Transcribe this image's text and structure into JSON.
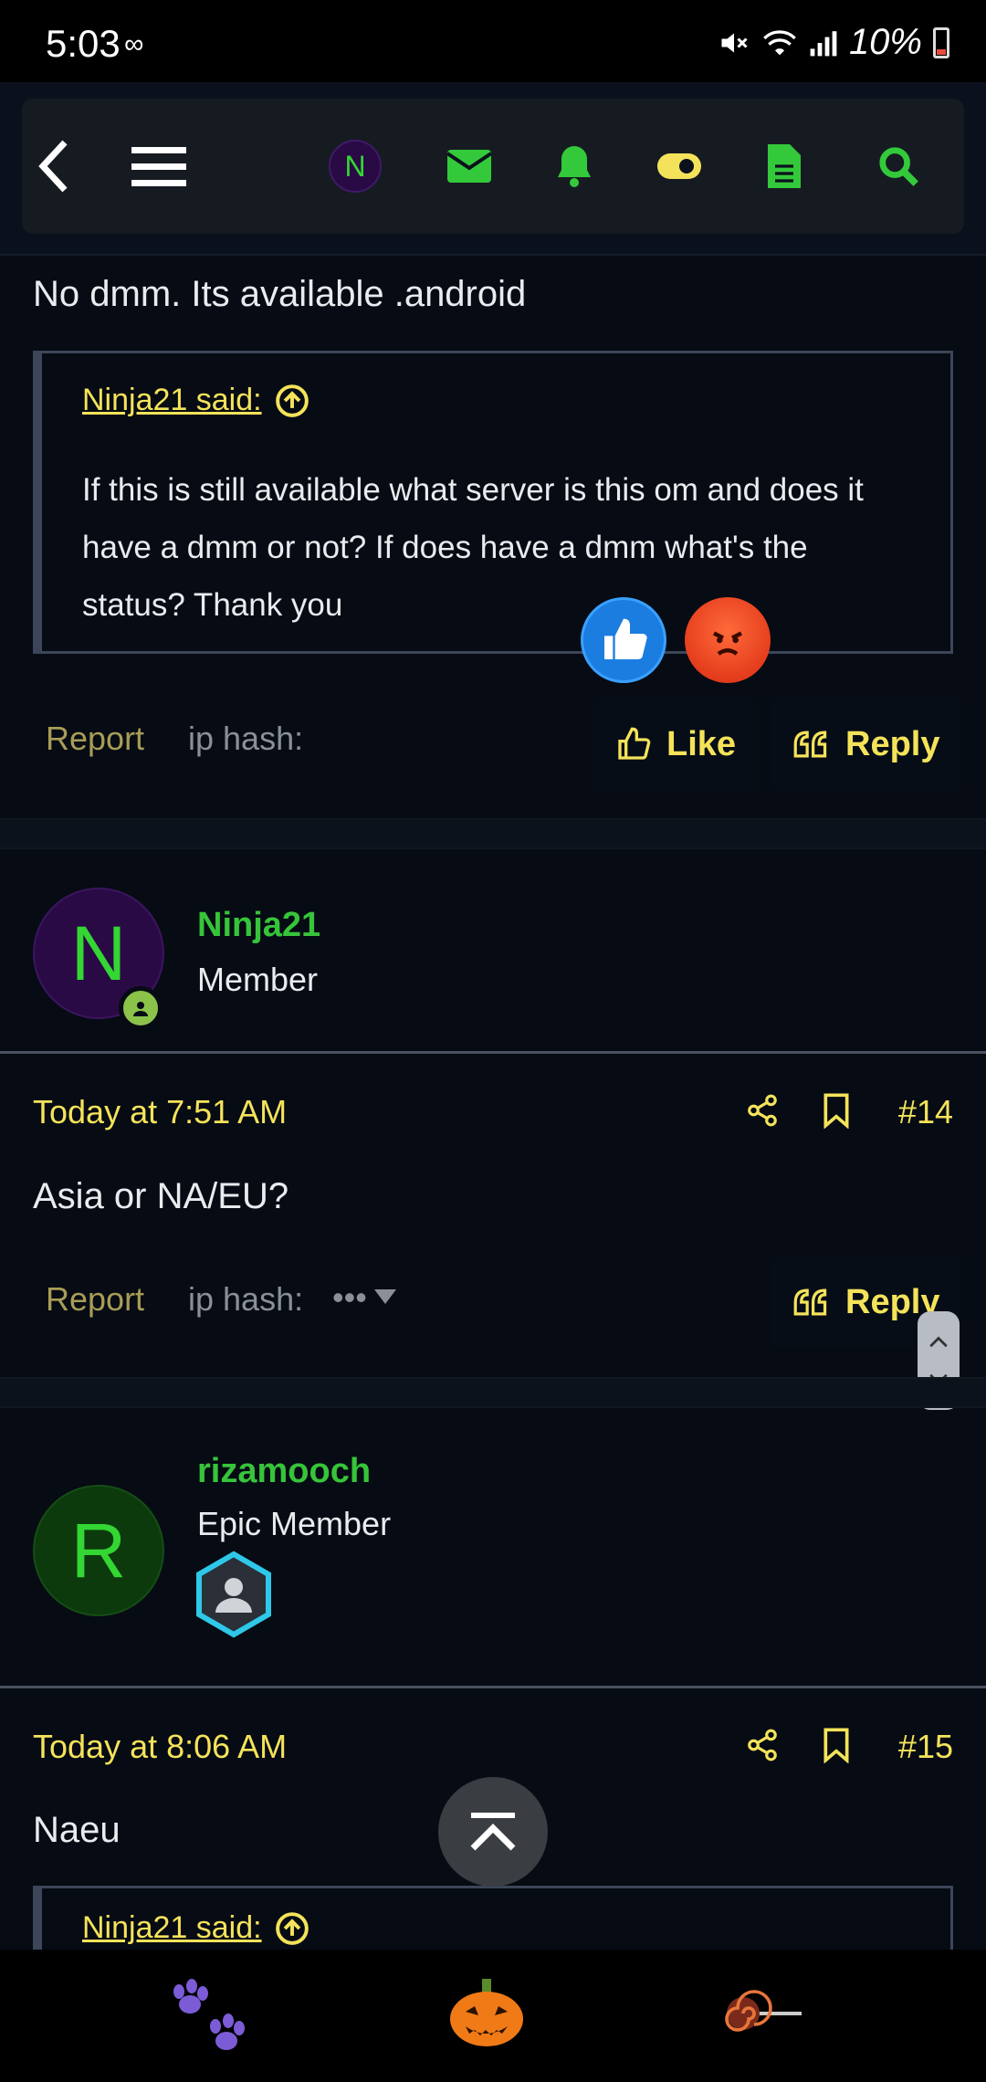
{
  "status": {
    "time": "5:03",
    "battery": "10%"
  },
  "nav": {
    "avatar_letter": "N",
    "icons": [
      "back-icon",
      "menu-icon",
      "avatar",
      "mail-icon",
      "bell-icon",
      "toggle-icon",
      "document-icon",
      "search-icon"
    ]
  },
  "post13": {
    "body": "No dmm. Its available .android",
    "quote_author": "Ninja21 said:",
    "quote_text": "If this is still available what server is this om and does it have a dmm or not? If does have a dmm what's the status? Thank you",
    "report": "Report",
    "iphash": "ip hash:",
    "like": "Like",
    "reply": "Reply"
  },
  "user14": {
    "letter": "N",
    "name": "Ninja21",
    "title": "Member"
  },
  "post14": {
    "date": "Today at 7:51 AM",
    "num": "#14",
    "body": "Asia or NA/EU?",
    "report": "Report",
    "iphash": "ip hash:",
    "iphash_more": "•••",
    "reply": "Reply"
  },
  "user15": {
    "letter": "R",
    "name": "rizamooch",
    "title": "Epic Member"
  },
  "post15": {
    "date": "Today at 8:06 AM",
    "num": "#15",
    "body": "Naeu",
    "quote_author": "Ninja21 said:"
  },
  "colors": {
    "accent": "#f4e35a",
    "username": "#37c43a",
    "background": "#060b14"
  }
}
